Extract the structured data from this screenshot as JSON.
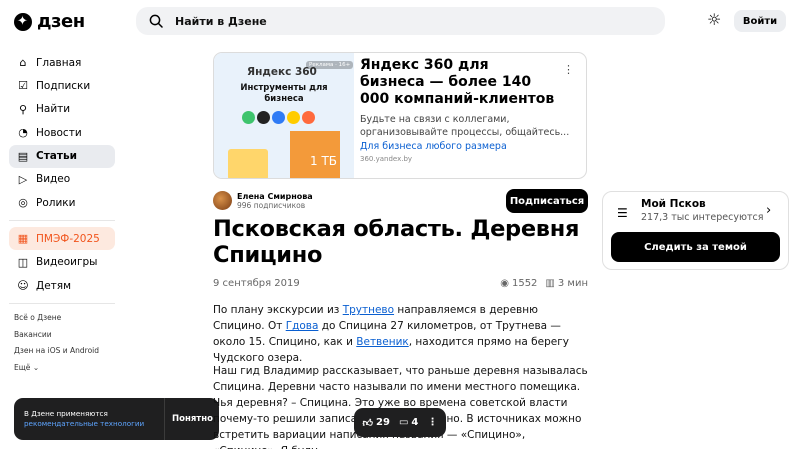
{
  "header": {
    "logo_text": "дзен",
    "search_placeholder": "Найти в Дзене",
    "login_label": "Войти"
  },
  "sidebar": {
    "items": [
      {
        "label": "Главная",
        "icon": "home-icon"
      },
      {
        "label": "Подписки",
        "icon": "subscriptions-icon"
      },
      {
        "label": "Найти",
        "icon": "search-icon"
      },
      {
        "label": "Новости",
        "icon": "news-icon"
      },
      {
        "label": "Статьи",
        "icon": "articles-icon"
      },
      {
        "label": "Видео",
        "icon": "video-icon"
      },
      {
        "label": "Ролики",
        "icon": "shorts-icon"
      }
    ],
    "promo": {
      "label": "ПМЭФ-2025"
    },
    "extra": [
      {
        "label": "Видеоигры",
        "icon": "gamepad-icon"
      },
      {
        "label": "Детям",
        "icon": "kids-icon"
      }
    ],
    "footer": [
      "Всё о Дзене",
      "Вакансии",
      "Дзен на iOS и Android",
      "Ещё"
    ]
  },
  "ad": {
    "brand": "Яндекс 360",
    "label": "Реклама · 16+",
    "image_headline": "Инструменты для бизнеса",
    "image_size": "1 ТБ",
    "title": "Яндекс 360 для бизнеса — более 140 000 компаний-клиентов",
    "description": "Будьте на связи с коллегами, организовывайте процессы, общайтесь...",
    "cta": "Для бизнеса любого размера",
    "domain": "360.yandex.by"
  },
  "author": {
    "name": "Елена Смирнова",
    "subscribers": "996 подписчиков",
    "subscribe_label": "Подписаться"
  },
  "article": {
    "title": "Псковская область. Деревня Спицино",
    "date": "9 сентября 2019",
    "views": "1552",
    "read_time": "3 мин",
    "p1": {
      "t1": "По плану экскурсии из ",
      "link1": "Трутнево",
      "t2": " направляемся в деревню Спицино. От ",
      "link2": "Гдова",
      "t3": " до Спицина 27 километров, от Трутнева  — около 15. Спицино, как и ",
      "link3": "Ветвеник",
      "t4": ", находится прямо на берегу Чудского озера."
    },
    "p2": "Наш гид Владимир рассказывает, что раньше деревня называлась Спицина. Деревни часто называли по имени местного помещика. Чья деревня? – Спицина. Это уже во времена советской власти почему-то решили записать её как Спицино. В источниках можно встретить вариации  написания названия — «Спицино», «Спицино». Я буду"
  },
  "actions": {
    "likes": "29",
    "comments": "4"
  },
  "channel": {
    "name": "Мой Псков",
    "followers": "217,3 тыс интересуются",
    "button_label": "Следить за темой"
  },
  "cookie": {
    "text": "В Дзене применяются",
    "link": "рекомендательные технологии",
    "button": "Понятно"
  }
}
